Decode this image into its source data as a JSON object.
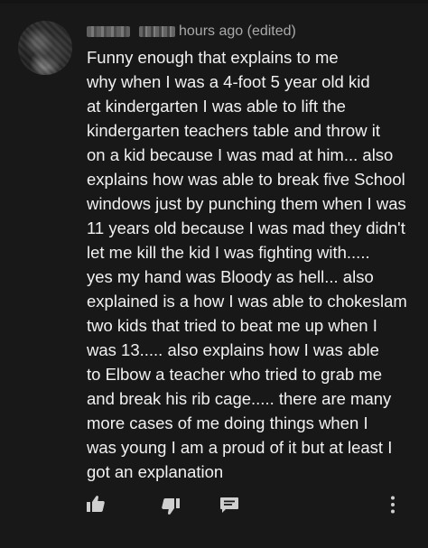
{
  "comment": {
    "time_suffix": "hours ago (edited)",
    "text_lines": [
      "Funny enough that explains to me",
      "why when I was a 4-foot 5 year old kid",
      "at kindergarten I was able to lift the",
      "kindergarten teachers table and throw it",
      "on a kid because I was mad at him... also",
      "explains how was able to break five School",
      "windows just by punching them when I was",
      "11 years old because I was mad they didn't",
      "let me kill the kid I was fighting with.....",
      "yes my hand was Bloody as hell... also",
      "explained is a how I was able to chokeslam",
      "two kids that tried to beat me up when I",
      "was 13..... also explains how I was able",
      "to Elbow a teacher who tried to grab me",
      "and break his rib cage..... there are many",
      "more cases of me doing things when I",
      "was young I am a proud of it but at least I",
      "got an explanation"
    ]
  },
  "actions": {
    "like_icon": "thumbs-up-icon",
    "dislike_icon": "thumbs-down-icon",
    "reply_icon": "reply-comment-icon",
    "more_icon": "more-vertical-icon"
  },
  "colors": {
    "background": "#181818",
    "text": "#f1f1f1",
    "meta": "#aaaaaa",
    "icon": "#cfcfcf"
  }
}
